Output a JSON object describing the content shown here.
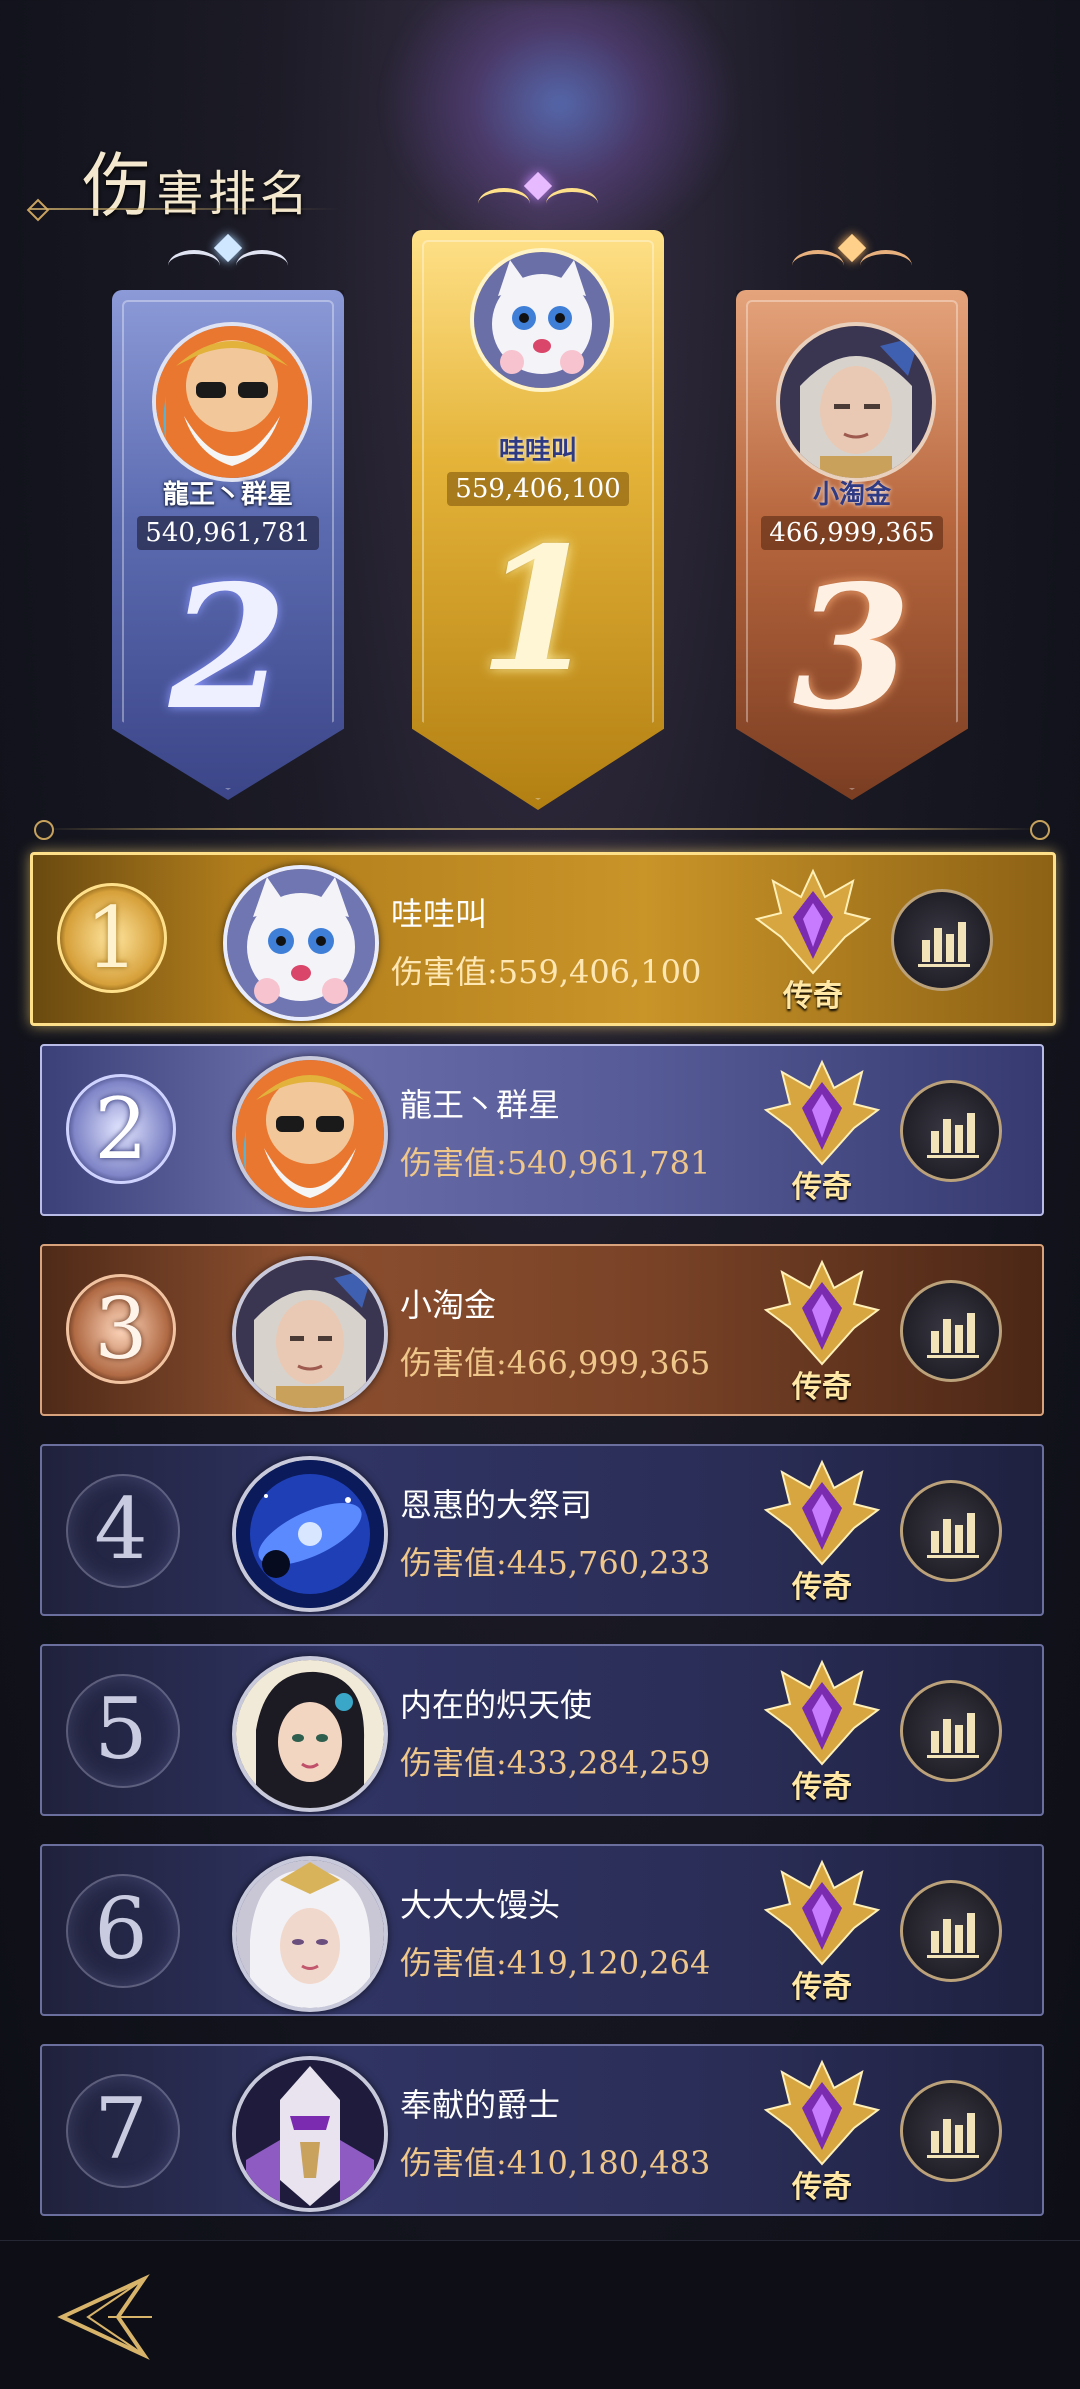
{
  "header": {
    "title_first": "伤",
    "title_rest": "害排名"
  },
  "podium": [
    {
      "rank": "2",
      "name": "龍王丶群星",
      "score": "540,961,781",
      "tier": "silver"
    },
    {
      "rank": "1",
      "name": "哇哇叫",
      "score": "559,406,100",
      "tier": "gold"
    },
    {
      "rank": "3",
      "name": "小淘金",
      "score": "466,999,365",
      "tier": "bronze"
    }
  ],
  "list": [
    {
      "rank": "1",
      "name": "哇哇叫",
      "score_label": "伤害值:559,406,100",
      "badge": "传奇",
      "style": "gold",
      "avatar": "white-kitten"
    },
    {
      "rank": "2",
      "name": "龍王丶群星",
      "score_label": "伤害值:540,961,781",
      "badge": "传奇",
      "style": "silver",
      "avatar": "sunglasses-elder"
    },
    {
      "rank": "3",
      "name": "小淘金",
      "score_label": "伤害值:466,999,365",
      "badge": "传奇",
      "style": "bronze",
      "avatar": "silver-haired-man"
    },
    {
      "rank": "4",
      "name": "恩惠的大祭司",
      "score_label": "伤害值:445,760,233",
      "badge": "传奇",
      "style": "plain",
      "avatar": "blue-galaxy"
    },
    {
      "rank": "5",
      "name": "内在的炽天使",
      "score_label": "伤害值:433,284,259",
      "badge": "传奇",
      "style": "plain",
      "avatar": "dark-haired-woman"
    },
    {
      "rank": "6",
      "name": "大大大馒头",
      "score_label": "伤害值:419,120,264",
      "badge": "传奇",
      "style": "plain",
      "avatar": "white-haired-woman"
    },
    {
      "rank": "7",
      "name": "奉献的爵士",
      "score_label": "伤害值:410,180,483",
      "badge": "传奇",
      "style": "plain",
      "avatar": "masked-knight"
    }
  ],
  "icons": {
    "back": "back-arrow-icon",
    "stats": "bar-chart-icon",
    "badge": "legend-rank-icon"
  },
  "colors": {
    "gold": "#d6a03a",
    "silver": "#7f85c7",
    "bronze": "#b06a44",
    "score_text": "#f0c78a",
    "badge_purple": "#7a2bb0"
  }
}
